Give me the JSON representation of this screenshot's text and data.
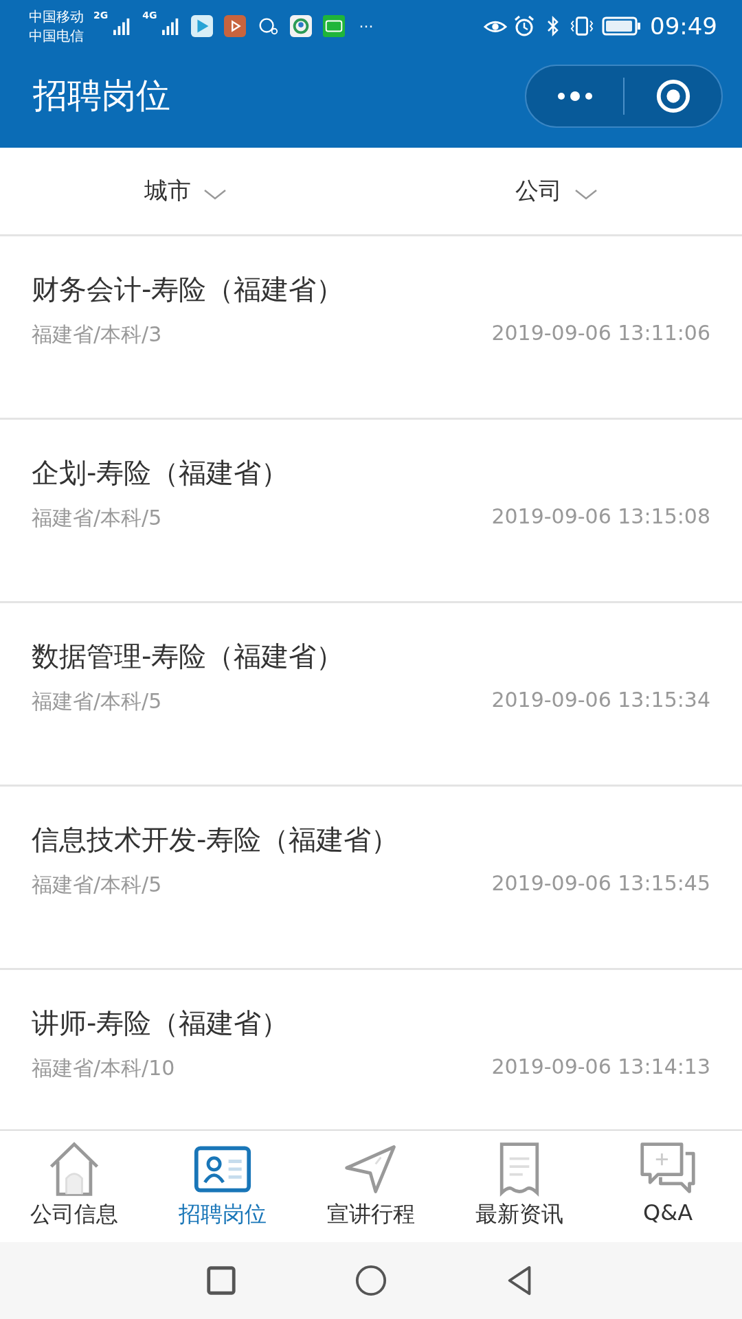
{
  "status_bar": {
    "carriers": [
      "中国移动",
      "中国电信"
    ],
    "networks": [
      "2G",
      "4G"
    ],
    "more": "···",
    "time": "09:49"
  },
  "header": {
    "title": "招聘岗位"
  },
  "filters": [
    {
      "label": "城市"
    },
    {
      "label": "公司"
    }
  ],
  "jobs": [
    {
      "title": "财务会计-寿险（福建省）",
      "meta": "福建省/本科/3",
      "time": "2019-09-06 13:11:06"
    },
    {
      "title": "企划-寿险（福建省）",
      "meta": "福建省/本科/5",
      "time": "2019-09-06 13:15:08"
    },
    {
      "title": "数据管理-寿险（福建省）",
      "meta": "福建省/本科/5",
      "time": "2019-09-06 13:15:34"
    },
    {
      "title": "信息技术开发-寿险（福建省）",
      "meta": "福建省/本科/5",
      "time": "2019-09-06 13:15:45"
    },
    {
      "title": "讲师-寿险（福建省）",
      "meta": "福建省/本科/10",
      "time": "2019-09-06 13:14:13"
    }
  ],
  "tab_bar": [
    {
      "label": "公司信息",
      "selected": false
    },
    {
      "label": "招聘岗位",
      "selected": true
    },
    {
      "label": "宣讲行程",
      "selected": false
    },
    {
      "label": "最新资讯",
      "selected": false
    },
    {
      "label": "Q&A",
      "selected": false
    }
  ]
}
